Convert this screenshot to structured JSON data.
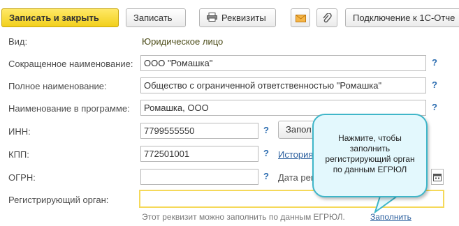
{
  "toolbar": {
    "save_close_label": "Записать и закрыть",
    "save_label": "Записать",
    "requisites_label": "Реквизиты",
    "connection_label": "Подключение к 1С-Отче"
  },
  "form": {
    "kind_label": "Вид:",
    "kind_value": "Юридическое лицо",
    "short_name_label": "Сокращенное наименование:",
    "short_name_value": "ООО \"Ромашка\"",
    "full_name_label": "Полное наименование:",
    "full_name_value": "Общество с ограниченной ответственностью \"Ромашка\"",
    "program_name_label": "Наименование в программе:",
    "program_name_value": "Ромашка, ООО",
    "inn_label": "ИНН:",
    "inn_value": "7799555550",
    "fill_button_label": "Запол",
    "kpp_label": "КПП:",
    "kpp_value": "772501001",
    "history_link": "История",
    "ogrn_label": "ОГРН:",
    "ogrn_value": "",
    "date_label": "Дата рег",
    "reg_authority_label": "Регистрирующий орган:",
    "reg_authority_value": "",
    "hint_text": "Этот реквизит можно заполнить по данным ЕГРЮЛ.",
    "fill_link": "Заполнить",
    "help_mark": "?"
  },
  "tooltip": {
    "lines": [
      "Нажмите, чтобы",
      "заполнить",
      "регистрирующий орган",
      "по данным ЕГРЮЛ"
    ]
  },
  "colors": {
    "primary_button": "#f2cf1b",
    "tooltip_bg": "#e3f8fd",
    "tooltip_border": "#3fb6c9",
    "help": "#2b6cb0"
  }
}
